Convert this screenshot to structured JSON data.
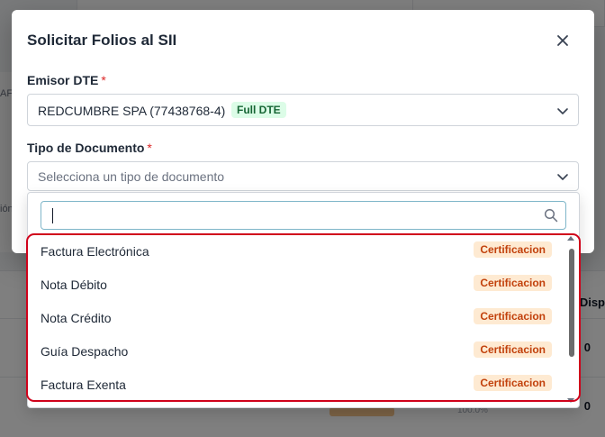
{
  "background": {
    "left_fragments": [
      "AF(",
      "ión"
    ],
    "column_header": "Disp",
    "row_values": [
      "0",
      "0"
    ],
    "percent": "100.0%"
  },
  "modal": {
    "title": "Solicitar Folios al SII",
    "close_icon": "close-icon",
    "emisor": {
      "label": "Emisor DTE",
      "required_mark": "*",
      "value": "REDCUMBRE SPA (77438768-4)",
      "badge": "Full DTE"
    },
    "tipo_documento": {
      "label": "Tipo de Documento",
      "required_mark": "*",
      "placeholder": "Selecciona un tipo de documento"
    }
  },
  "dropdown": {
    "search": {
      "value": "",
      "icon": "search-icon"
    },
    "options": [
      {
        "label": "Factura Electrónica",
        "badge": "Certificacion"
      },
      {
        "label": "Nota Débito",
        "badge": "Certificacion"
      },
      {
        "label": "Nota Crédito",
        "badge": "Certificacion"
      },
      {
        "label": "Guía Despacho",
        "badge": "Certificacion"
      },
      {
        "label": "Factura Exenta",
        "badge": "Certificacion"
      }
    ]
  },
  "colors": {
    "highlight": "#d0021b",
    "success_badge_bg": "#dcfce7",
    "warning_badge_bg": "#feead2",
    "required": "#dc2626"
  }
}
